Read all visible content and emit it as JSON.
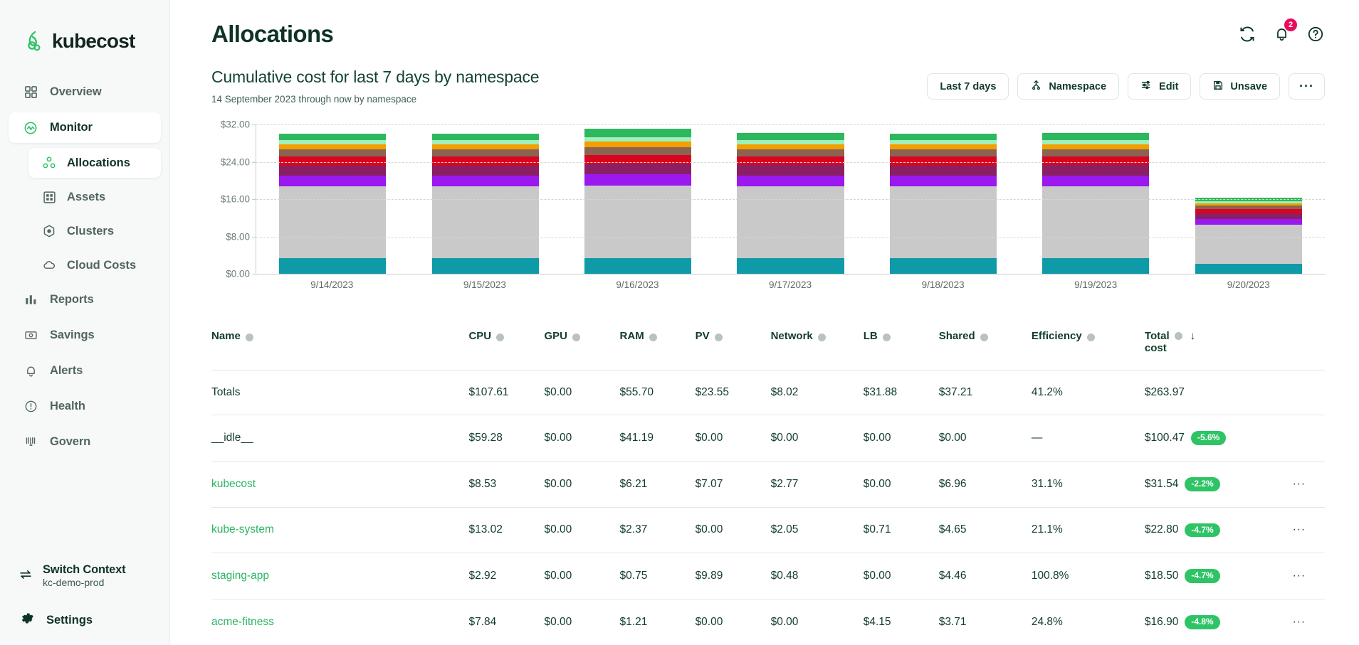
{
  "sidebar": {
    "brand": "kubecost",
    "items": [
      {
        "label": "Overview",
        "icon": "grid-icon",
        "active": false
      },
      {
        "label": "Monitor",
        "icon": "monitor-icon",
        "active": true
      },
      {
        "label": "Reports",
        "icon": "bar-chart-icon",
        "active": false
      },
      {
        "label": "Savings",
        "icon": "money-icon",
        "active": false
      },
      {
        "label": "Alerts",
        "icon": "bell-icon",
        "active": false
      },
      {
        "label": "Health",
        "icon": "alert-circle-icon",
        "active": false
      },
      {
        "label": "Govern",
        "icon": "govern-icon",
        "active": false
      }
    ],
    "sub_items": [
      {
        "label": "Allocations",
        "icon": "allocations-icon",
        "active": true
      },
      {
        "label": "Assets",
        "icon": "assets-icon",
        "active": false
      },
      {
        "label": "Clusters",
        "icon": "clusters-icon",
        "active": false
      },
      {
        "label": "Cloud Costs",
        "icon": "cloud-icon",
        "active": false
      }
    ],
    "switch_context": {
      "title": "Switch Context",
      "subtitle": "kc-demo-prod",
      "icon": "switch-icon"
    },
    "settings": {
      "label": "Settings",
      "icon": "gear-icon"
    }
  },
  "header": {
    "title": "Allocations",
    "refresh_icon": "refresh-icon",
    "notifications_icon": "bell-icon",
    "notifications_count": "2",
    "help_icon": "help-circle-icon",
    "badge_color": "#ec0a5c"
  },
  "chart_header": {
    "title": "Cumulative cost for last 7 days by namespace",
    "subtitle": "14 September 2023 through now by namespace"
  },
  "toolbar": {
    "date_range": "Last 7 days",
    "aggregation": "Namespace",
    "aggregation_icon": "hierarchy-icon",
    "edit": "Edit",
    "edit_icon": "sliders-icon",
    "unsave": "Unsave",
    "unsave_icon": "save-icon",
    "more": "···"
  },
  "chart_data": {
    "type": "bar",
    "stacked": true,
    "title": "Cumulative cost for last 7 days by namespace",
    "xlabel": "",
    "ylabel": "",
    "ylim": [
      0,
      32
    ],
    "grid": true,
    "legend": "none",
    "categories": [
      "9/14/2023",
      "9/15/2023",
      "9/16/2023",
      "9/17/2023",
      "9/18/2023",
      "9/19/2023",
      "9/20/2023"
    ],
    "ytick_labels": [
      "$0.00",
      "$8.00",
      "$16.00",
      "$24.00",
      "$32.00"
    ],
    "ytick_values": [
      0,
      8,
      16,
      24,
      32
    ],
    "series": [
      {
        "name": "teal-segment",
        "color": "#0e9aa7",
        "values": [
          3.4,
          3.4,
          3.4,
          3.4,
          3.4,
          3.4,
          2.1
        ]
      },
      {
        "name": "idle-grey-segment",
        "color": "#c9c9c9",
        "values": [
          15.3,
          15.3,
          15.5,
          15.4,
          15.3,
          15.4,
          8.4
        ]
      },
      {
        "name": "purple-segment",
        "color": "#9b18ef",
        "values": [
          2.3,
          2.3,
          2.4,
          2.3,
          2.3,
          2.3,
          1.3
        ]
      },
      {
        "name": "magenta-segment",
        "color": "#8a1f63",
        "values": [
          2.2,
          2.2,
          2.2,
          2.2,
          2.2,
          2.2,
          1.1
        ]
      },
      {
        "name": "red-segment",
        "color": "#d90420",
        "values": [
          1.9,
          1.9,
          2.0,
          1.9,
          1.9,
          1.9,
          0.9
        ]
      },
      {
        "name": "brown-segment",
        "color": "#8b6451",
        "values": [
          1.5,
          1.5,
          1.6,
          1.5,
          1.5,
          1.5,
          0.8
        ]
      },
      {
        "name": "orange-segment",
        "color": "#f59e00",
        "values": [
          1.1,
          1.1,
          1.2,
          1.1,
          1.1,
          1.1,
          0.5
        ]
      },
      {
        "name": "mint-segment",
        "color": "#9ff0bd",
        "values": [
          0.9,
          0.9,
          1.0,
          0.9,
          0.9,
          0.9,
          0.5
        ]
      },
      {
        "name": "green-segment",
        "color": "#2eb85d",
        "values": [
          1.4,
          1.4,
          1.8,
          1.4,
          1.4,
          1.4,
          0.7
        ]
      }
    ]
  },
  "table": {
    "columns": [
      {
        "key": "name",
        "label": "Name",
        "info": true,
        "sorted": false
      },
      {
        "key": "cpu",
        "label": "CPU",
        "info": true,
        "sorted": false
      },
      {
        "key": "gpu",
        "label": "GPU",
        "info": true,
        "sorted": false
      },
      {
        "key": "ram",
        "label": "RAM",
        "info": true,
        "sorted": false
      },
      {
        "key": "pv",
        "label": "PV",
        "info": true,
        "sorted": false
      },
      {
        "key": "network",
        "label": "Network",
        "info": true,
        "sorted": false
      },
      {
        "key": "lb",
        "label": "LB",
        "info": true,
        "sorted": false
      },
      {
        "key": "shared",
        "label": "Shared",
        "info": true,
        "sorted": false
      },
      {
        "key": "efficiency",
        "label": "Efficiency",
        "info": true,
        "sorted": false
      },
      {
        "key": "total",
        "label": "Total cost",
        "info": true,
        "sorted": true,
        "sort_icon": "↓"
      }
    ],
    "rows": [
      {
        "name": "Totals",
        "link": false,
        "cpu": "$107.61",
        "gpu": "$0.00",
        "ram": "$55.70",
        "pv": "$23.55",
        "network": "$8.02",
        "lb": "$31.88",
        "shared": "$37.21",
        "efficiency": "41.2%",
        "total": "$263.97",
        "chip": "",
        "actions": ""
      },
      {
        "name": "__idle__",
        "link": false,
        "cpu": "$59.28",
        "gpu": "$0.00",
        "ram": "$41.19",
        "pv": "$0.00",
        "network": "$0.00",
        "lb": "$0.00",
        "shared": "$0.00",
        "efficiency": "—",
        "total": "$100.47",
        "chip": "-5.6%",
        "actions": ""
      },
      {
        "name": "kubecost",
        "link": true,
        "cpu": "$8.53",
        "gpu": "$0.00",
        "ram": "$6.21",
        "pv": "$7.07",
        "network": "$2.77",
        "lb": "$0.00",
        "shared": "$6.96",
        "efficiency": "31.1%",
        "total": "$31.54",
        "chip": "-2.2%",
        "actions": "···"
      },
      {
        "name": "kube-system",
        "link": true,
        "cpu": "$13.02",
        "gpu": "$0.00",
        "ram": "$2.37",
        "pv": "$0.00",
        "network": "$2.05",
        "lb": "$0.71",
        "shared": "$4.65",
        "efficiency": "21.1%",
        "total": "$22.80",
        "chip": "-4.7%",
        "actions": "···"
      },
      {
        "name": "staging-app",
        "link": true,
        "cpu": "$2.92",
        "gpu": "$0.00",
        "ram": "$0.75",
        "pv": "$9.89",
        "network": "$0.48",
        "lb": "$0.00",
        "shared": "$4.46",
        "efficiency": "100.8%",
        "total": "$18.50",
        "chip": "-4.7%",
        "actions": "···"
      },
      {
        "name": "acme-fitness",
        "link": true,
        "cpu": "$7.84",
        "gpu": "$0.00",
        "ram": "$1.21",
        "pv": "$0.00",
        "network": "$0.00",
        "lb": "$4.15",
        "shared": "$3.71",
        "efficiency": "24.8%",
        "total": "$16.90",
        "chip": "-4.8%",
        "actions": "···"
      }
    ],
    "chip_color": "#2ec466",
    "link_color": "#2ab563"
  }
}
